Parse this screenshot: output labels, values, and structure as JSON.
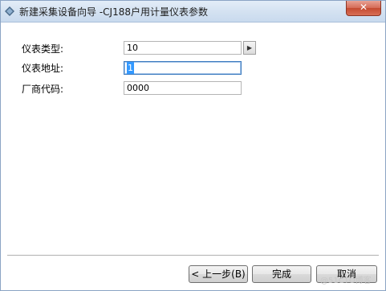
{
  "window": {
    "title": "新建采集设备向导 -CJ188户用计量仪表参数",
    "close_label": "✕",
    "app_icon": "diamond-app-icon"
  },
  "form": {
    "fields": [
      {
        "label": "仪表类型:",
        "value": "10"
      },
      {
        "label": "仪表地址:",
        "value": "1"
      },
      {
        "label": "厂商代码:",
        "value": "0000"
      }
    ],
    "spin_label": "▶"
  },
  "footer": {
    "back_label": "< 上一步(B)",
    "finish_label": "完成",
    "cancel_label": "取消"
  },
  "watermark": "@51CTO博客",
  "colors": {
    "titlebar": "#d3e1f1",
    "close_button": "#c44a31",
    "focus_border": "#3d7bbf",
    "selection": "#3399ff"
  }
}
